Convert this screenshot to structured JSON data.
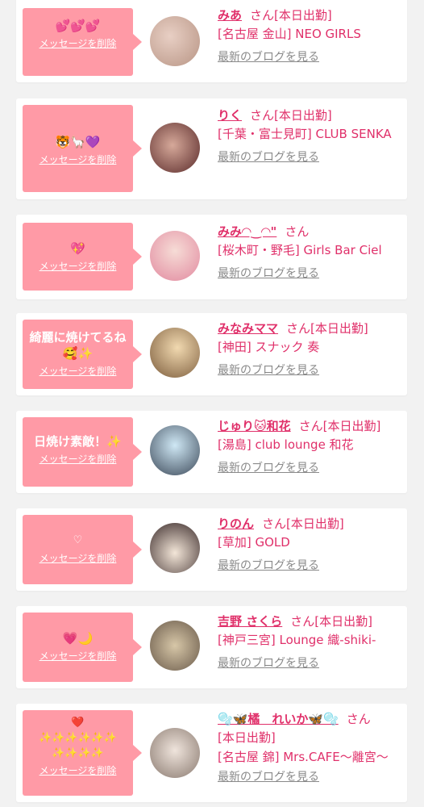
{
  "cards": [
    {
      "message": "💕💕💕",
      "delete_label": "メッセージを削除",
      "name": "みあ",
      "san": "さん",
      "status": "[本日出勤]",
      "shop": "[名古屋 金山] NEO GIRLS",
      "blog": "最新のブログを見る"
    },
    {
      "message": "🐯🦙💜",
      "delete_label": "メッセージを削除",
      "name": "りく",
      "san": "さん",
      "status": "[本日出勤]",
      "shop": "[千葉・富士見町] CLUB SENKA",
      "blog": "最新のブログを見る"
    },
    {
      "message": "💖",
      "delete_label": "メッセージを削除",
      "name": "みみ◠‿◠\"",
      "san": "さん",
      "status": "",
      "shop": "[桜木町・野毛] Girls Bar Ciel",
      "blog": "最新のブログを見る"
    },
    {
      "message": "綺麗に焼けてるね\n🥰✨",
      "delete_label": "メッセージを削除",
      "name": "みなみママ",
      "san": "さん",
      "status": "[本日出勤]",
      "shop": "[神田] スナック 奏",
      "blog": "最新のブログを見る"
    },
    {
      "message": "日焼け素敵！✨",
      "delete_label": "メッセージを削除",
      "name": "じゅり🐱和花",
      "san": "さん",
      "status": "[本日出勤]",
      "shop": "[湯島] club lounge 和花",
      "blog": "最新のブログを見る"
    },
    {
      "message": "♡",
      "delete_label": "メッセージを削除",
      "name": "りのん",
      "san": "さん",
      "status": "[本日出勤]",
      "shop": "[草加] GOLD",
      "blog": "最新のブログを見る"
    },
    {
      "message": "💗🌙",
      "delete_label": "メッセージを削除",
      "name": "吉野 さくら",
      "san": "さん",
      "status": "[本日出勤]",
      "shop": "[神戸三宮] Lounge 織-shiki-",
      "blog": "最新のブログを見る"
    },
    {
      "message": "❤️\n✨✨✨✨✨✨\n✨✨✨✨",
      "delete_label": "メッセージを削除",
      "name": "🫧🦋橘　れいか🦋🫧",
      "san": "さん",
      "status": "[本日出勤]",
      "shop": "[名古屋 錦] Mrs.CAFE〜離宮〜",
      "blog": "最新のブログを見る"
    }
  ],
  "colors": {
    "bubble": "#ff9aa6",
    "name": "#e0306a",
    "blog": "#8a8a8a",
    "background": "#f2f2f2"
  }
}
